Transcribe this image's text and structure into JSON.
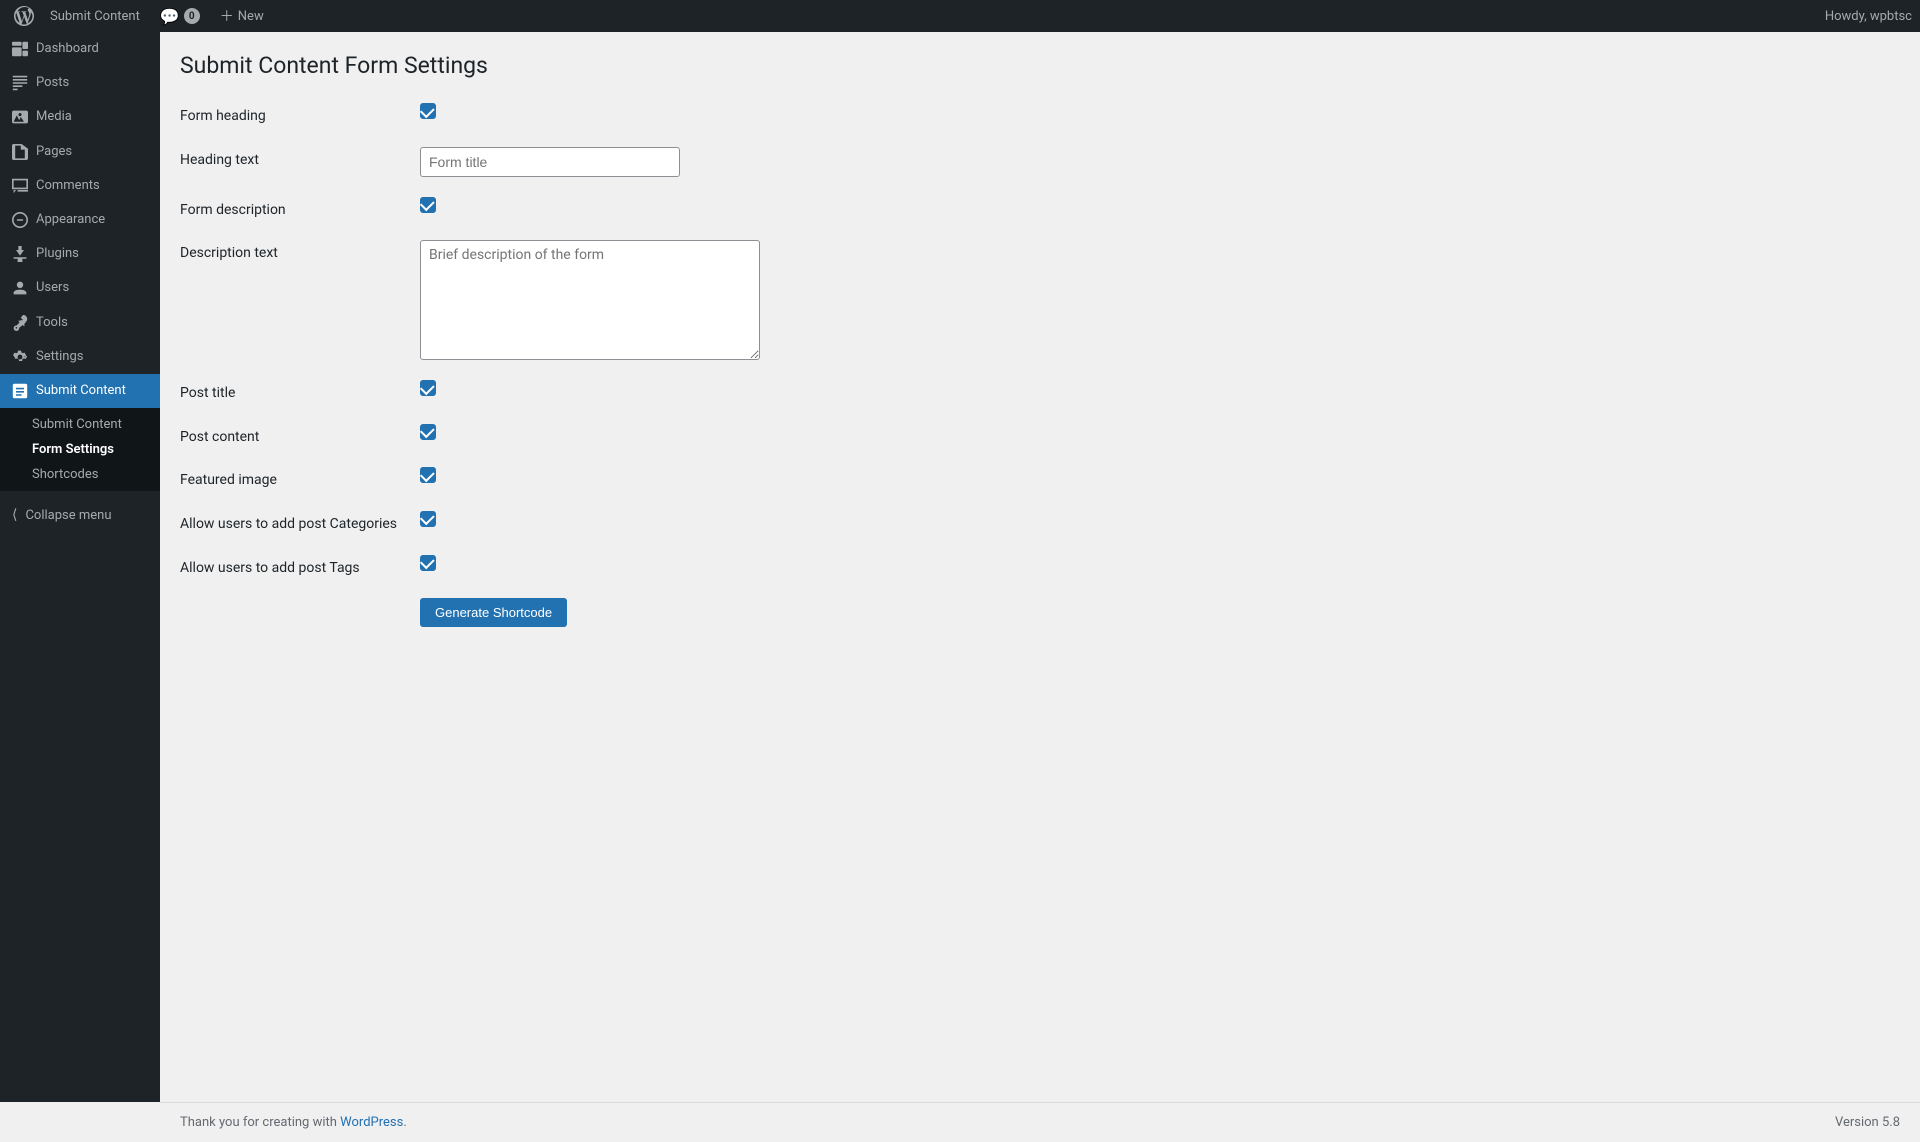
{
  "topbar": {
    "site_name": "Submit Content",
    "comments_label": "0",
    "new_label": "New",
    "howdy": "Howdy, wpbtsc"
  },
  "sidebar": {
    "items": [
      {
        "id": "dashboard",
        "label": "Dashboard",
        "icon": "dashboard"
      },
      {
        "id": "posts",
        "label": "Posts",
        "icon": "posts"
      },
      {
        "id": "media",
        "label": "Media",
        "icon": "media"
      },
      {
        "id": "pages",
        "label": "Pages",
        "icon": "pages"
      },
      {
        "id": "comments",
        "label": "Comments",
        "icon": "comments"
      },
      {
        "id": "appearance",
        "label": "Appearance",
        "icon": "appearance"
      },
      {
        "id": "plugins",
        "label": "Plugins",
        "icon": "plugins"
      },
      {
        "id": "users",
        "label": "Users",
        "icon": "users"
      },
      {
        "id": "tools",
        "label": "Tools",
        "icon": "tools"
      },
      {
        "id": "settings",
        "label": "Settings",
        "icon": "settings"
      },
      {
        "id": "submit-content",
        "label": "Submit Content",
        "icon": "submit-content",
        "active": true
      }
    ],
    "submenu": [
      {
        "id": "submit-content-sub",
        "label": "Submit Content"
      },
      {
        "id": "form-settings",
        "label": "Form Settings",
        "active": true
      },
      {
        "id": "shortcodes",
        "label": "Shortcodes"
      }
    ],
    "collapse_label": "Collapse menu"
  },
  "page": {
    "title": "Submit Content Form Settings",
    "form": {
      "form_heading_label": "Form heading",
      "form_heading_checked": true,
      "heading_text_label": "Heading text",
      "heading_text_value": "",
      "heading_text_placeholder": "Form title",
      "form_description_label": "Form description",
      "form_description_checked": true,
      "description_text_label": "Description text",
      "description_text_placeholder": "Brief description of the form",
      "post_title_label": "Post title",
      "post_title_checked": true,
      "post_content_label": "Post content",
      "post_content_checked": true,
      "featured_image_label": "Featured image",
      "featured_image_checked": true,
      "categories_label": "Allow users to add post Categories",
      "categories_checked": true,
      "tags_label": "Allow users to add post Tags",
      "tags_checked": true,
      "generate_button_label": "Generate Shortcode"
    }
  },
  "footer": {
    "thank_you_text": "Thank you for creating with ",
    "wordpress_link": "WordPress",
    "version_label": "Version 5.8"
  }
}
